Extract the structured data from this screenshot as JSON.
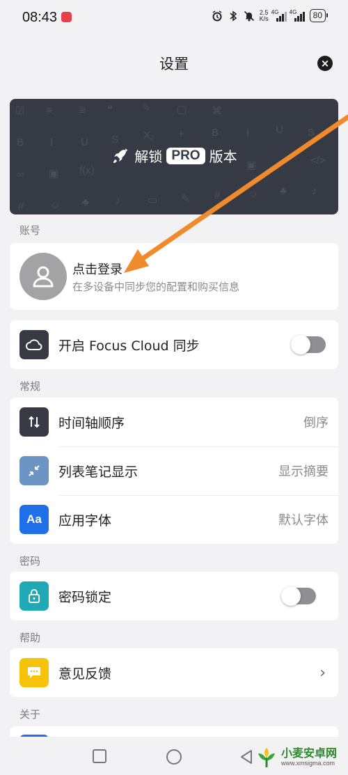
{
  "status_bar": {
    "time": "08:43",
    "net_speed_value": "2.5",
    "net_speed_unit": "K/s",
    "signal1_tag": "4G",
    "signal2_tag": "4G",
    "battery": "80"
  },
  "header": {
    "title": "设置",
    "close_icon": "close-icon"
  },
  "pro_banner": {
    "prefix": "解锁",
    "badge": "PRO",
    "suffix": "版本",
    "background": "#363a44"
  },
  "account": {
    "section_label": "账号",
    "login_title": "点击登录",
    "login_subtitle": "在多设备中同步您的配置和购买信息"
  },
  "cloud": {
    "label": "开启 Focus Cloud 同步",
    "enabled": false,
    "icon": "cloud-icon",
    "icon_color": "#363a44"
  },
  "general": {
    "section_label": "常规",
    "items": [
      {
        "label": "时间轴顺序",
        "value": "倒序",
        "icon": "sort-arrows-icon",
        "icon_color": "#363a44"
      },
      {
        "label": "列表笔记显示",
        "value": "显示摘要",
        "icon": "collapse-arrows-icon",
        "icon_color": "#6d95c4"
      },
      {
        "label": "应用字体",
        "value": "默认字体",
        "icon": "font-icon",
        "icon_color": "#1f6fe8",
        "icon_text": "Aa"
      }
    ]
  },
  "password": {
    "section_label": "密码",
    "label": "密码锁定",
    "enabled": false,
    "icon": "lock-icon",
    "icon_color": "#1ea9b4"
  },
  "help": {
    "section_label": "帮助",
    "label": "意见反馈",
    "icon": "chat-bubble-icon",
    "icon_color": "#f7c20a"
  },
  "about": {
    "section_label": "关于"
  },
  "watermark": {
    "text": "小麦安卓网",
    "url": "www.xmsigma.com"
  },
  "annotation_color": "#f08a2c"
}
